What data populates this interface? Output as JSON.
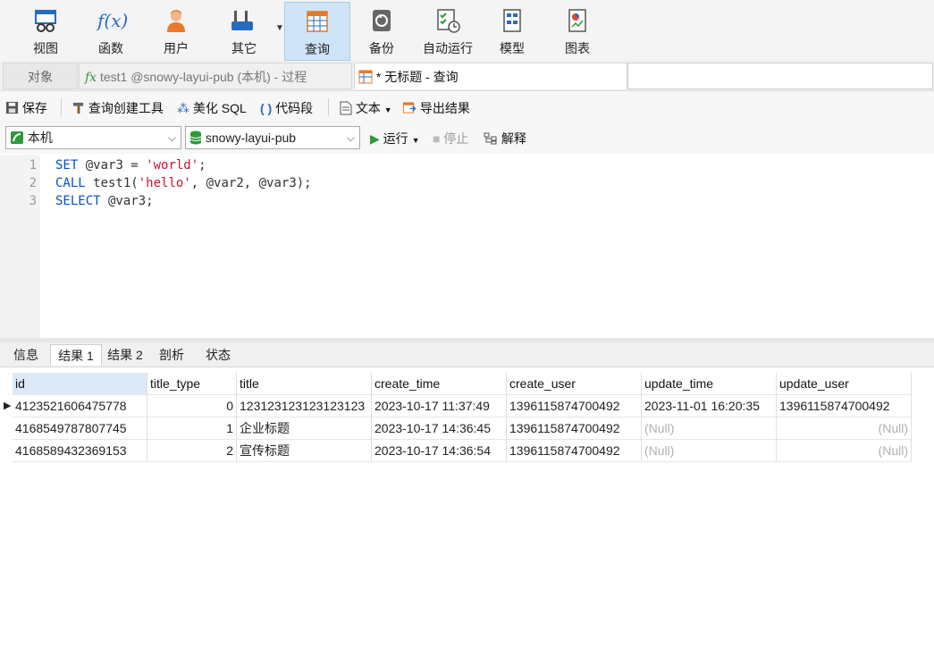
{
  "ribbon": {
    "buttons": [
      {
        "id": "view",
        "label": "视图"
      },
      {
        "id": "func",
        "label": "函数"
      },
      {
        "id": "user",
        "label": "用户"
      },
      {
        "id": "other",
        "label": "其它"
      },
      {
        "id": "query",
        "label": "查询"
      },
      {
        "id": "backup",
        "label": "备份"
      },
      {
        "id": "auto",
        "label": "自动运行"
      },
      {
        "id": "model",
        "label": "模型"
      },
      {
        "id": "chart",
        "label": "图表"
      }
    ],
    "func_icon_text": "f(x)"
  },
  "tabs": {
    "objects": "对象",
    "proc": "test1 @snowy-layui-pub (本机) - 过程",
    "proc_icon": "fx",
    "query": "* 无标题 - 查询"
  },
  "toolbar": {
    "save": "保存",
    "query_builder": "查询创建工具",
    "beautify": "美化 SQL",
    "snippet": "代码段",
    "text": "文本",
    "export": "导出结果"
  },
  "connection": {
    "host": "本机",
    "database": "snowy-layui-pub",
    "run": "运行",
    "stop": "停止",
    "explain": "解释"
  },
  "editor": {
    "lines": [
      {
        "n": "1"
      },
      {
        "n": "2"
      },
      {
        "n": "3"
      }
    ],
    "l1_kw": "SET",
    "l1_mid": " @var3 = ",
    "l1_str": "'world'",
    "l1_end": ";",
    "l2_kw": "CALL",
    "l2_mid": " test1(",
    "l2_str": "'hello'",
    "l2_end": ", @var2, @var3);",
    "l3_kw": "SELECT",
    "l3_end": " @var3;"
  },
  "result_tabs": [
    "信息",
    "结果 1",
    "结果 2",
    "剖析",
    "状态"
  ],
  "grid": {
    "columns": [
      "id",
      "title_type",
      "title",
      "create_time",
      "create_user",
      "update_time",
      "update_user"
    ],
    "rows": [
      [
        "4123521606475778",
        "0",
        "123123123123123123",
        "2023-10-17 11:37:49",
        "1396115874700492",
        "2023-11-01 16:20:35",
        "1396115874700492"
      ],
      [
        "4168549787807745",
        "1",
        "企业标题",
        "2023-10-17 14:36:45",
        "1396115874700492",
        "(Null)",
        "(Null)"
      ],
      [
        "4168589432369153",
        "2",
        "宣传标题",
        "2023-10-17 14:36:54",
        "1396115874700492",
        "(Null)",
        "(Null)"
      ]
    ]
  },
  "colors": {
    "accent": "#0050c8",
    "string": "#c8142c",
    "active_tab": "#cfe4f7"
  }
}
